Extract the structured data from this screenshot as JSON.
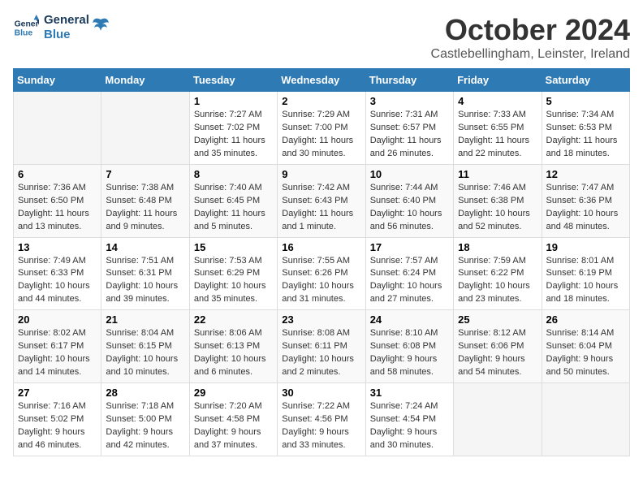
{
  "header": {
    "logo_line1": "General",
    "logo_line2": "Blue",
    "month": "October 2024",
    "location": "Castlebellingham, Leinster, Ireland"
  },
  "weekdays": [
    "Sunday",
    "Monday",
    "Tuesday",
    "Wednesday",
    "Thursday",
    "Friday",
    "Saturday"
  ],
  "weeks": [
    [
      {
        "day": "",
        "info": ""
      },
      {
        "day": "",
        "info": ""
      },
      {
        "day": "1",
        "info": "Sunrise: 7:27 AM\nSunset: 7:02 PM\nDaylight: 11 hours and 35 minutes."
      },
      {
        "day": "2",
        "info": "Sunrise: 7:29 AM\nSunset: 7:00 PM\nDaylight: 11 hours and 30 minutes."
      },
      {
        "day": "3",
        "info": "Sunrise: 7:31 AM\nSunset: 6:57 PM\nDaylight: 11 hours and 26 minutes."
      },
      {
        "day": "4",
        "info": "Sunrise: 7:33 AM\nSunset: 6:55 PM\nDaylight: 11 hours and 22 minutes."
      },
      {
        "day": "5",
        "info": "Sunrise: 7:34 AM\nSunset: 6:53 PM\nDaylight: 11 hours and 18 minutes."
      }
    ],
    [
      {
        "day": "6",
        "info": "Sunrise: 7:36 AM\nSunset: 6:50 PM\nDaylight: 11 hours and 13 minutes."
      },
      {
        "day": "7",
        "info": "Sunrise: 7:38 AM\nSunset: 6:48 PM\nDaylight: 11 hours and 9 minutes."
      },
      {
        "day": "8",
        "info": "Sunrise: 7:40 AM\nSunset: 6:45 PM\nDaylight: 11 hours and 5 minutes."
      },
      {
        "day": "9",
        "info": "Sunrise: 7:42 AM\nSunset: 6:43 PM\nDaylight: 11 hours and 1 minute."
      },
      {
        "day": "10",
        "info": "Sunrise: 7:44 AM\nSunset: 6:40 PM\nDaylight: 10 hours and 56 minutes."
      },
      {
        "day": "11",
        "info": "Sunrise: 7:46 AM\nSunset: 6:38 PM\nDaylight: 10 hours and 52 minutes."
      },
      {
        "day": "12",
        "info": "Sunrise: 7:47 AM\nSunset: 6:36 PM\nDaylight: 10 hours and 48 minutes."
      }
    ],
    [
      {
        "day": "13",
        "info": "Sunrise: 7:49 AM\nSunset: 6:33 PM\nDaylight: 10 hours and 44 minutes."
      },
      {
        "day": "14",
        "info": "Sunrise: 7:51 AM\nSunset: 6:31 PM\nDaylight: 10 hours and 39 minutes."
      },
      {
        "day": "15",
        "info": "Sunrise: 7:53 AM\nSunset: 6:29 PM\nDaylight: 10 hours and 35 minutes."
      },
      {
        "day": "16",
        "info": "Sunrise: 7:55 AM\nSunset: 6:26 PM\nDaylight: 10 hours and 31 minutes."
      },
      {
        "day": "17",
        "info": "Sunrise: 7:57 AM\nSunset: 6:24 PM\nDaylight: 10 hours and 27 minutes."
      },
      {
        "day": "18",
        "info": "Sunrise: 7:59 AM\nSunset: 6:22 PM\nDaylight: 10 hours and 23 minutes."
      },
      {
        "day": "19",
        "info": "Sunrise: 8:01 AM\nSunset: 6:19 PM\nDaylight: 10 hours and 18 minutes."
      }
    ],
    [
      {
        "day": "20",
        "info": "Sunrise: 8:02 AM\nSunset: 6:17 PM\nDaylight: 10 hours and 14 minutes."
      },
      {
        "day": "21",
        "info": "Sunrise: 8:04 AM\nSunset: 6:15 PM\nDaylight: 10 hours and 10 minutes."
      },
      {
        "day": "22",
        "info": "Sunrise: 8:06 AM\nSunset: 6:13 PM\nDaylight: 10 hours and 6 minutes."
      },
      {
        "day": "23",
        "info": "Sunrise: 8:08 AM\nSunset: 6:11 PM\nDaylight: 10 hours and 2 minutes."
      },
      {
        "day": "24",
        "info": "Sunrise: 8:10 AM\nSunset: 6:08 PM\nDaylight: 9 hours and 58 minutes."
      },
      {
        "day": "25",
        "info": "Sunrise: 8:12 AM\nSunset: 6:06 PM\nDaylight: 9 hours and 54 minutes."
      },
      {
        "day": "26",
        "info": "Sunrise: 8:14 AM\nSunset: 6:04 PM\nDaylight: 9 hours and 50 minutes."
      }
    ],
    [
      {
        "day": "27",
        "info": "Sunrise: 7:16 AM\nSunset: 5:02 PM\nDaylight: 9 hours and 46 minutes."
      },
      {
        "day": "28",
        "info": "Sunrise: 7:18 AM\nSunset: 5:00 PM\nDaylight: 9 hours and 42 minutes."
      },
      {
        "day": "29",
        "info": "Sunrise: 7:20 AM\nSunset: 4:58 PM\nDaylight: 9 hours and 37 minutes."
      },
      {
        "day": "30",
        "info": "Sunrise: 7:22 AM\nSunset: 4:56 PM\nDaylight: 9 hours and 33 minutes."
      },
      {
        "day": "31",
        "info": "Sunrise: 7:24 AM\nSunset: 4:54 PM\nDaylight: 9 hours and 30 minutes."
      },
      {
        "day": "",
        "info": ""
      },
      {
        "day": "",
        "info": ""
      }
    ]
  ]
}
